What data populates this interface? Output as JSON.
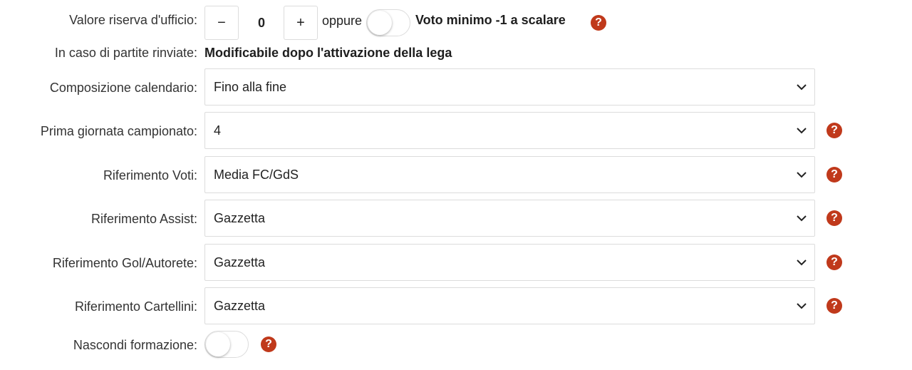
{
  "reserve": {
    "label": "Valore riserva d'ufficio:",
    "minus": "−",
    "value": "0",
    "plus": "+",
    "or_text": "oppure",
    "toggle_on": false,
    "toggle_text": "Voto minimo -1 a scalare"
  },
  "postponed": {
    "label": "In caso di partite rinviate:",
    "value": "Modificabile dopo l'attivazione della lega"
  },
  "selects": [
    {
      "label": "Composizione calendario:",
      "value": "Fino alla fine",
      "help": false
    },
    {
      "label": "Prima giornata campionato:",
      "value": "4",
      "help": true
    },
    {
      "label": "Riferimento Voti:",
      "value": "Media FC/GdS",
      "help": true
    },
    {
      "label": "Riferimento Assist:",
      "value": "Gazzetta",
      "help": true
    },
    {
      "label": "Riferimento Gol/Autorete:",
      "value": "Gazzetta",
      "help": true
    },
    {
      "label": "Riferimento Cartellini:",
      "value": "Gazzetta",
      "help": true
    }
  ],
  "hide_lineup": {
    "label": "Nascondi formazione:",
    "toggle_on": false
  },
  "help_symbol": "?",
  "colors": {
    "help": "#c0391b",
    "border": "#dcdcdc"
  }
}
